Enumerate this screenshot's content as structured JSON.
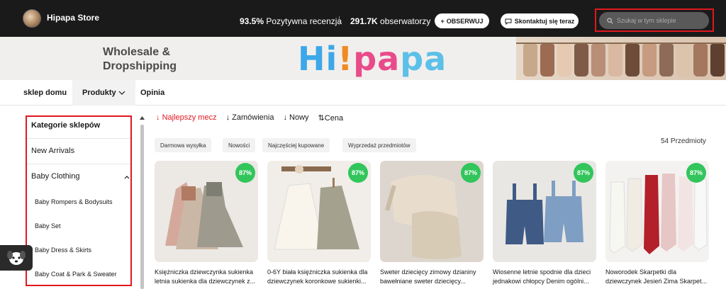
{
  "store": {
    "name": "Hipapa Store",
    "rating_value": "93.5%",
    "rating_label": "Pozytywna recenzja",
    "followers_value": "291.7K",
    "followers_label": "obserwatorzy",
    "follow_label": "OBSERWUJ",
    "contact_label": "Skontaktuj się teraz",
    "search_placeholder": "Szukaj w tym sklepie"
  },
  "banner": {
    "text_line1": "Wholesale &",
    "text_line2": "Dropshipping",
    "logo_parts": [
      "Hi",
      "!",
      "pa",
      "pa"
    ]
  },
  "nav": {
    "tabs": [
      {
        "label": "sklep domu"
      },
      {
        "label": "Produkty"
      },
      {
        "label": "Opinia"
      }
    ]
  },
  "sidebar": {
    "heading": "Kategorie sklepów",
    "items": [
      {
        "label": "New Arrivals"
      },
      {
        "label": "Baby Clothing"
      }
    ],
    "subitems": [
      {
        "label": "Baby Rompers & Bodysuits"
      },
      {
        "label": "Baby Set"
      },
      {
        "label": "Baby Dress & Skirts"
      },
      {
        "label": "Baby Coat & Park & Sweater"
      }
    ]
  },
  "sort": {
    "options": [
      "Najlepszy mecz",
      "Zamówienia",
      "Nowy",
      "Cena"
    ]
  },
  "filters": {
    "chips": [
      "Darmowa wysyłka",
      "Nowości",
      "Najczęściej kupowane",
      "Wyprzedaż przedmiotów"
    ],
    "count": "54 Przedmioty"
  },
  "products": [
    {
      "badge": "87%",
      "title_line1": "Księżniczka dziewczynka sukienka",
      "title_line2": "letnia sukienka dla dziewczynek z..."
    },
    {
      "badge": "87%",
      "title_line1": "0-6Y biała księżniczka sukienka dla",
      "title_line2": "dziewczynek koronkowe sukienki..."
    },
    {
      "badge": "87%",
      "title_line1": "Sweter dziecięcy zimowy dzianiny",
      "title_line2": "bawełniane sweter dziecięcy..."
    },
    {
      "badge": "87%",
      "title_line1": "Wiosenne letnie spodnie dla dzieci",
      "title_line2": "jednakowi chłopcy Denim ogólni..."
    },
    {
      "badge": "87%",
      "title_line1": "Noworodek Skarpetki dla",
      "title_line2": "dziewczynek Jesień Zima Skarpet..."
    }
  ],
  "colors": {
    "topbar": "#1a1a1a",
    "accent_red": "#e0181f",
    "badge_green": "#32c55b"
  }
}
